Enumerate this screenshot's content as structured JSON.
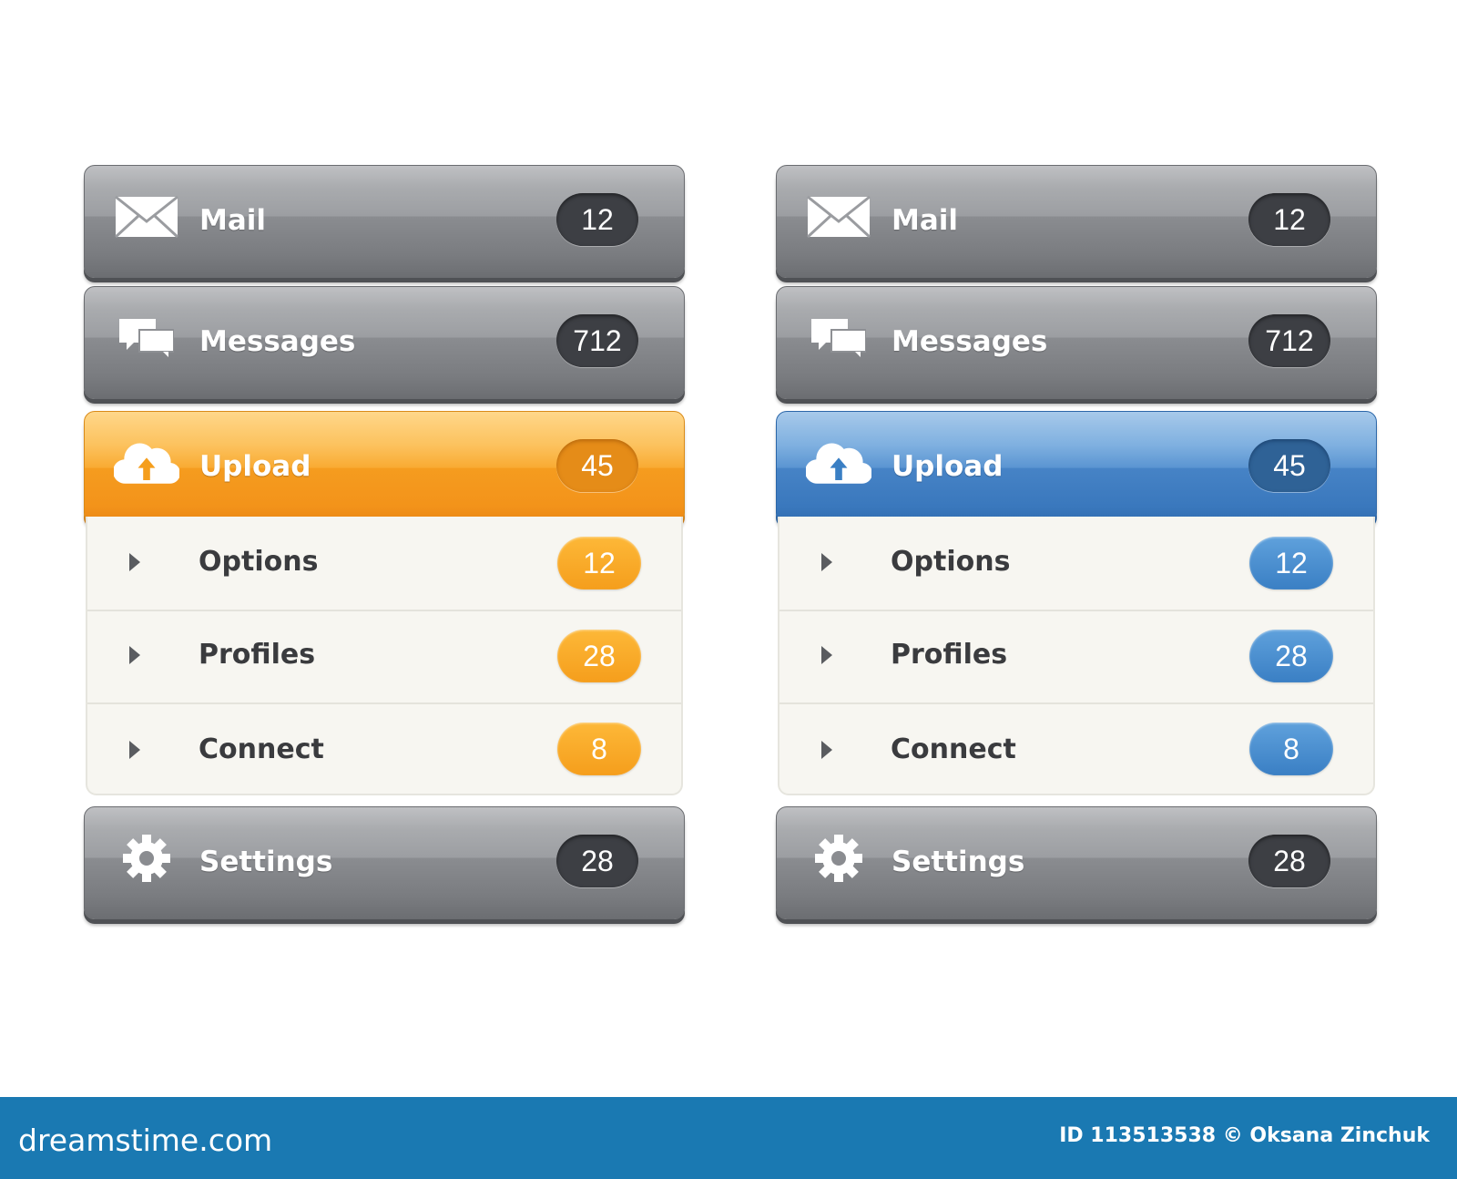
{
  "menus": [
    {
      "theme": "orange",
      "items": [
        {
          "label": "Mail",
          "count": "12",
          "icon": "mail-icon"
        },
        {
          "label": "Messages",
          "count": "712",
          "icon": "messages-icon"
        },
        {
          "label": "Upload",
          "count": "45",
          "icon": "cloud-upload-icon"
        },
        {
          "label": "Settings",
          "count": "28",
          "icon": "gear-icon"
        }
      ],
      "submenu": [
        {
          "label": "Options",
          "count": "12"
        },
        {
          "label": "Profiles",
          "count": "28"
        },
        {
          "label": "Connect",
          "count": "8"
        }
      ],
      "accent": "#f59e1c"
    },
    {
      "theme": "blue",
      "items": [
        {
          "label": "Mail",
          "count": "12",
          "icon": "mail-icon"
        },
        {
          "label": "Messages",
          "count": "712",
          "icon": "messages-icon"
        },
        {
          "label": "Upload",
          "count": "45",
          "icon": "cloud-upload-icon"
        },
        {
          "label": "Settings",
          "count": "28",
          "icon": "gear-icon"
        }
      ],
      "submenu": [
        {
          "label": "Options",
          "count": "12"
        },
        {
          "label": "Profiles",
          "count": "28"
        },
        {
          "label": "Connect",
          "count": "8"
        }
      ],
      "accent": "#3a7fc4"
    }
  ],
  "footer": {
    "brand": "dreamstime.com",
    "credit": "ID 113513538 © Oksana Zinchuk",
    "color": "#1a79b2"
  }
}
